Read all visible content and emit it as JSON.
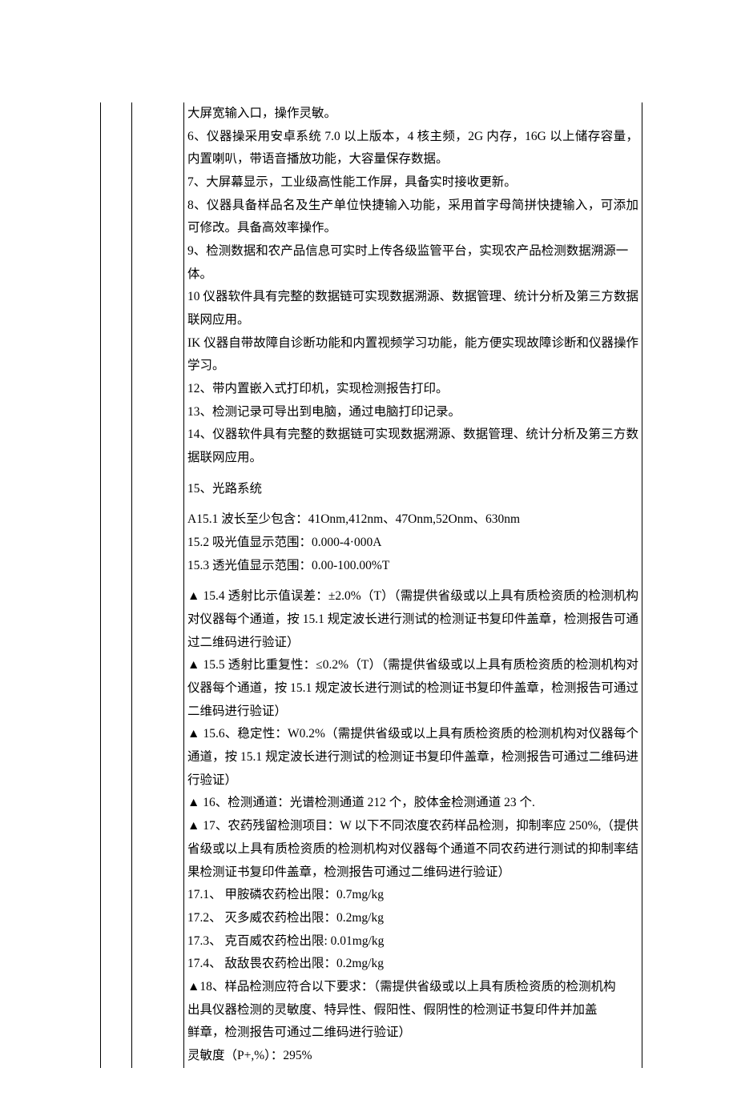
{
  "lines": [
    {
      "t": "大屏宽输入口，操作灵敏。"
    },
    {
      "t": "6、仪器操采用安卓系统 7.0 以上版本，4 核主频，2G 内存，16G 以上储存容量，内置喇叭，带语音播放功能，大容量保存数据。"
    },
    {
      "t": "7、大屏幕显示，工业级高性能工作屏，具备实时接收更新。"
    },
    {
      "t": "8、仪器具备样品名及生产单位快捷输入功能，采用首字母简拼快捷输入，可添加可修改。具备高效率操作。"
    },
    {
      "t": "9、检测数据和农产品信息可实时上传各级监管平台，实现农产品检测数据溯源一"
    },
    {
      "t": "体。",
      "cls": "indent"
    },
    {
      "t": "10 仪器软件具有完整的数据链可实现数据溯源、数据管理、统计分析及第三方数据联网应用。"
    },
    {
      "t": "IK 仪器自带故障自诊断功能和内置视频学习功能，能方便实现故障诊断和仪器操作学习。"
    },
    {
      "t": "12、带内置嵌入式打印机，实现检测报告打印。"
    },
    {
      "t": "13、检测记录可导出到电脑，通过电脑打印记录。"
    },
    {
      "t": "14、仪器软件具有完整的数据链可实现数据溯源、数据管理、统计分析及第三方数据联网应用。"
    },
    {
      "t": "15、光路系统",
      "gap": true
    },
    {
      "t": "A15.1 波长至少包含：41Onm,412nm、47Onm,52Onm、630nm",
      "gap": true
    },
    {
      "t": "15.2 吸光值显示范围：0.000-4·000A"
    },
    {
      "t": "15.3 透光值显示范围：0.00-100.00%T"
    },
    {
      "t": "▲ 15.4 透射比示值误差：±2.0%（T）（需提供省级或以上具有质检资质的检测机构对仪器每个通道，按 15.1 规定波长进行测试的检测证书复印件盖章，检测报告可通过二维码进行验证）",
      "gap": true
    },
    {
      "t": "▲ 15.5 透射比重复性：≤0.2%（T）（需提供省级或以上具有质检资质的检测机构对仪器每个通道，按 15.1 规定波长进行测试的检测证书复印件盖章，检测报告可通过二维码进行验证）"
    },
    {
      "t": "▲ 15.6、稳定性：W0.2%（需提供省级或以上具有质检资质的检测机构对仪器每个通道，按 15.1 规定波长进行测试的检测证书复印件盖章，检测报告可通过二维码进行验证）"
    },
    {
      "t": "▲ 16、检测通道：光谱检测通道 212 个，胶体金检测通道 23 个."
    },
    {
      "t": "▲ 17、农药残留检测项目：W 以下不同浓度农药样品检测，抑制率应 250%,（提供省级或以上具有质检资质的检测机构对仪器每个通道不同农药进行测试的抑制率结果检测证书复印件盖章，检测报告可通过二维码进行验证）"
    },
    {
      "t": "17.1、 甲胺磷农药检出限：0.7mg/kg"
    },
    {
      "t": "17.2、 灭多威农药检出限：0.2mg/kg"
    },
    {
      "t": "17.3、 克百威农药检出限: 0.01mg/kg"
    },
    {
      "t": "17.4、 敌敌畏农药检出限：0.2mg/kg"
    },
    {
      "t": "▲18、样品检测应符合以下要求：（需提供省级或以上具有质检资质的检测机构"
    },
    {
      "t": "出具仪器检测的灵敏度、特异性、假阳性、假阴性的检测证书复印件并加盖",
      "cls": "hanging"
    },
    {
      "t": "鲜章，检测报告可通过二维码进行验证）",
      "cls": "hanging"
    },
    {
      "t": "灵敏度（P+,%）：295%"
    }
  ]
}
